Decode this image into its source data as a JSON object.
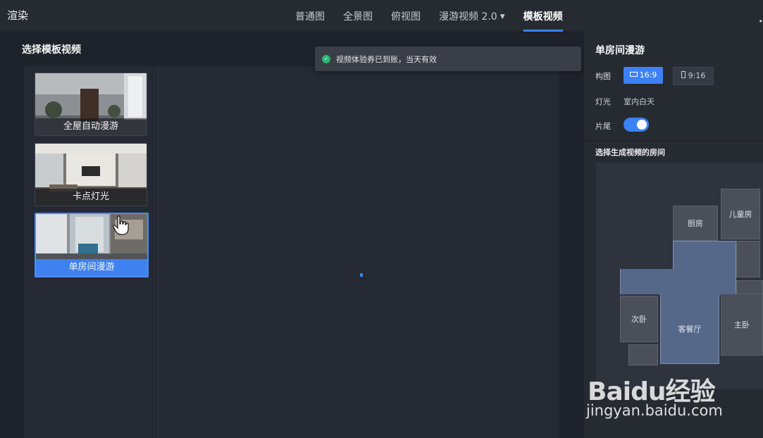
{
  "app": {
    "title": "渲染"
  },
  "tabs": [
    {
      "label": "普通图"
    },
    {
      "label": "全景图"
    },
    {
      "label": "俯视图"
    },
    {
      "label": "漫游视频 2.0"
    },
    {
      "label": "模板视频"
    }
  ],
  "left": {
    "title": "选择模板视频",
    "cards": [
      {
        "label": "全屋自动漫游"
      },
      {
        "label": "卡点灯光"
      },
      {
        "label": "单房间漫游"
      }
    ]
  },
  "toast": {
    "message": "视频体验券已到账，当天有效"
  },
  "right": {
    "title": "单房间漫游",
    "composition": {
      "label": "构图",
      "options": [
        "16:9",
        "9:16"
      ],
      "selected": "16:9"
    },
    "lighting": {
      "label": "灯光",
      "value": "室内白天"
    },
    "ending": {
      "label": "片尾",
      "enabled": true
    },
    "rooms_title": "选择生成视频的房间",
    "rooms": {
      "kitchen": "厨房",
      "kids": "儿童房",
      "living": "客餐厅",
      "second": "次卧",
      "master": "主卧"
    },
    "selected_room": "客餐厅"
  },
  "watermark": {
    "brand": "Baidu经验",
    "url": "jingyan.baidu.com"
  },
  "colors": {
    "accent": "#3b82f6",
    "success": "#2bb673"
  }
}
